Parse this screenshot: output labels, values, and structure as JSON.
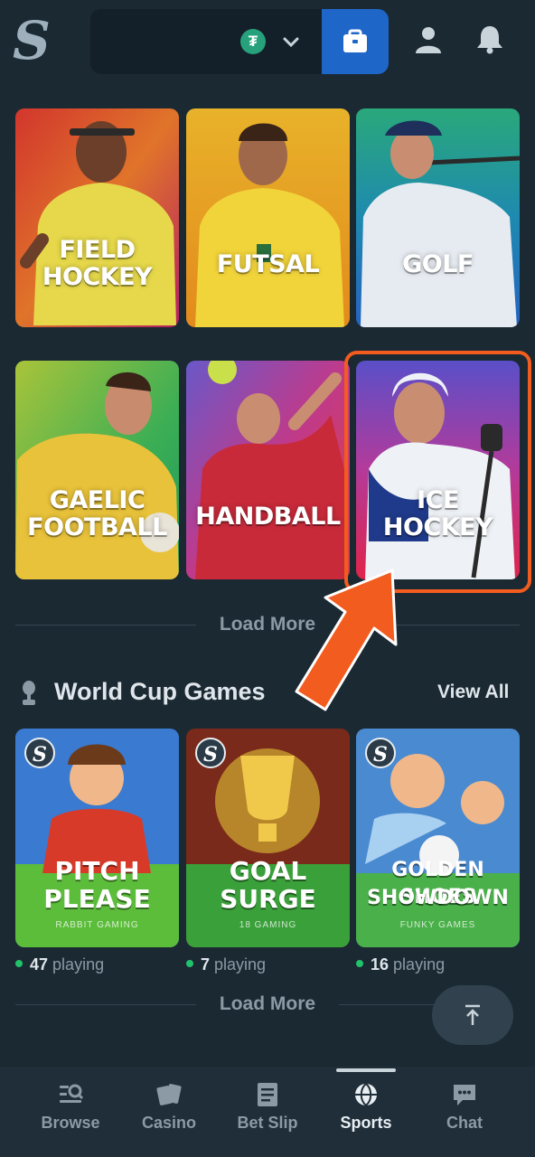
{
  "header": {
    "logo": "S",
    "currency_icon": "tether-icon",
    "currency_symbol": "₮"
  },
  "sports_tiles": [
    {
      "label_line1": "FIELD",
      "label_line2": "HOCKEY"
    },
    {
      "label_line1": "FUTSAL",
      "label_line2": ""
    },
    {
      "label_line1": "GOLF",
      "label_line2": ""
    },
    {
      "label_line1": "GAELIC",
      "label_line2": "FOOTBALL"
    },
    {
      "label_line1": "HANDBALL",
      "label_line2": ""
    },
    {
      "label_line1": "ICE",
      "label_line2": "HOCKEY"
    }
  ],
  "sports_load_more": "Load More",
  "world_cup": {
    "title": "World Cup Games",
    "view_all": "View All",
    "games": [
      {
        "title_line1": "PITCH",
        "title_line2": "PLEASE",
        "studio": "RABBIT GAMING",
        "players": "47",
        "playing_label": "playing"
      },
      {
        "title_line1": "GOAL",
        "title_line2": "SURGE",
        "studio": "18 GAMING",
        "players": "7",
        "playing_label": "playing"
      },
      {
        "title_line1": "GOLDEN SHOES",
        "title_line2": "SHOWDOWN",
        "studio": "FUNKY GAMES",
        "players": "16",
        "playing_label": "playing"
      }
    ],
    "load_more": "Load More"
  },
  "bottom_nav": [
    {
      "label": "Browse",
      "icon": "browse-icon"
    },
    {
      "label": "Casino",
      "icon": "casino-icon"
    },
    {
      "label": "Bet Slip",
      "icon": "bet-slip-icon"
    },
    {
      "label": "Sports",
      "icon": "sports-icon",
      "active": true
    },
    {
      "label": "Chat",
      "icon": "chat-icon"
    }
  ],
  "colors": {
    "background": "#1b2933",
    "accent_blue": "#1f66c9",
    "highlight_orange": "#f25c1e",
    "online_green": "#21c26b"
  }
}
